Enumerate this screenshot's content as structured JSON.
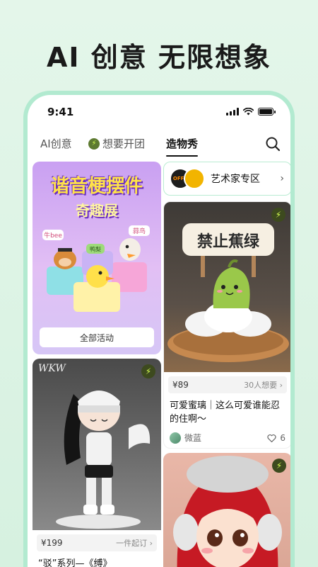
{
  "headline": "AI 创意 无限想象",
  "status": {
    "time": "9:41"
  },
  "tabs": [
    {
      "label": "AI创意"
    },
    {
      "label": "想要开团"
    },
    {
      "label": "造物秀"
    }
  ],
  "promo": {
    "title_line1": "谐音梗摆件",
    "title_line2": "奇趣展",
    "tags": [
      "牛bee",
      "鸭梨",
      "蒜鸟"
    ],
    "button_label": "全部活动"
  },
  "artist_bar": {
    "badge_text": "OFFA",
    "label": "艺术家专区"
  },
  "cards": [
    {
      "sign_text": "禁止蕉绿",
      "price": "¥89",
      "meta": "30人想要",
      "title": "可爱蜜璃｜这么可爱谁能忍的住啊～",
      "user": "微蓝",
      "likes": "6"
    },
    {
      "watermark": "WKW",
      "price": "¥199",
      "meta": "一件起订",
      "title": "“驳”系列—《缚》"
    },
    {}
  ],
  "colors": {
    "accent": "#b2ead0",
    "bolt": "#d6ff53",
    "background": "#e4f6ea"
  },
  "icons": [
    "search-icon",
    "bolt-icon",
    "heart-icon",
    "chevron-right-icon",
    "signal-icon",
    "wifi-icon",
    "battery-icon"
  ]
}
